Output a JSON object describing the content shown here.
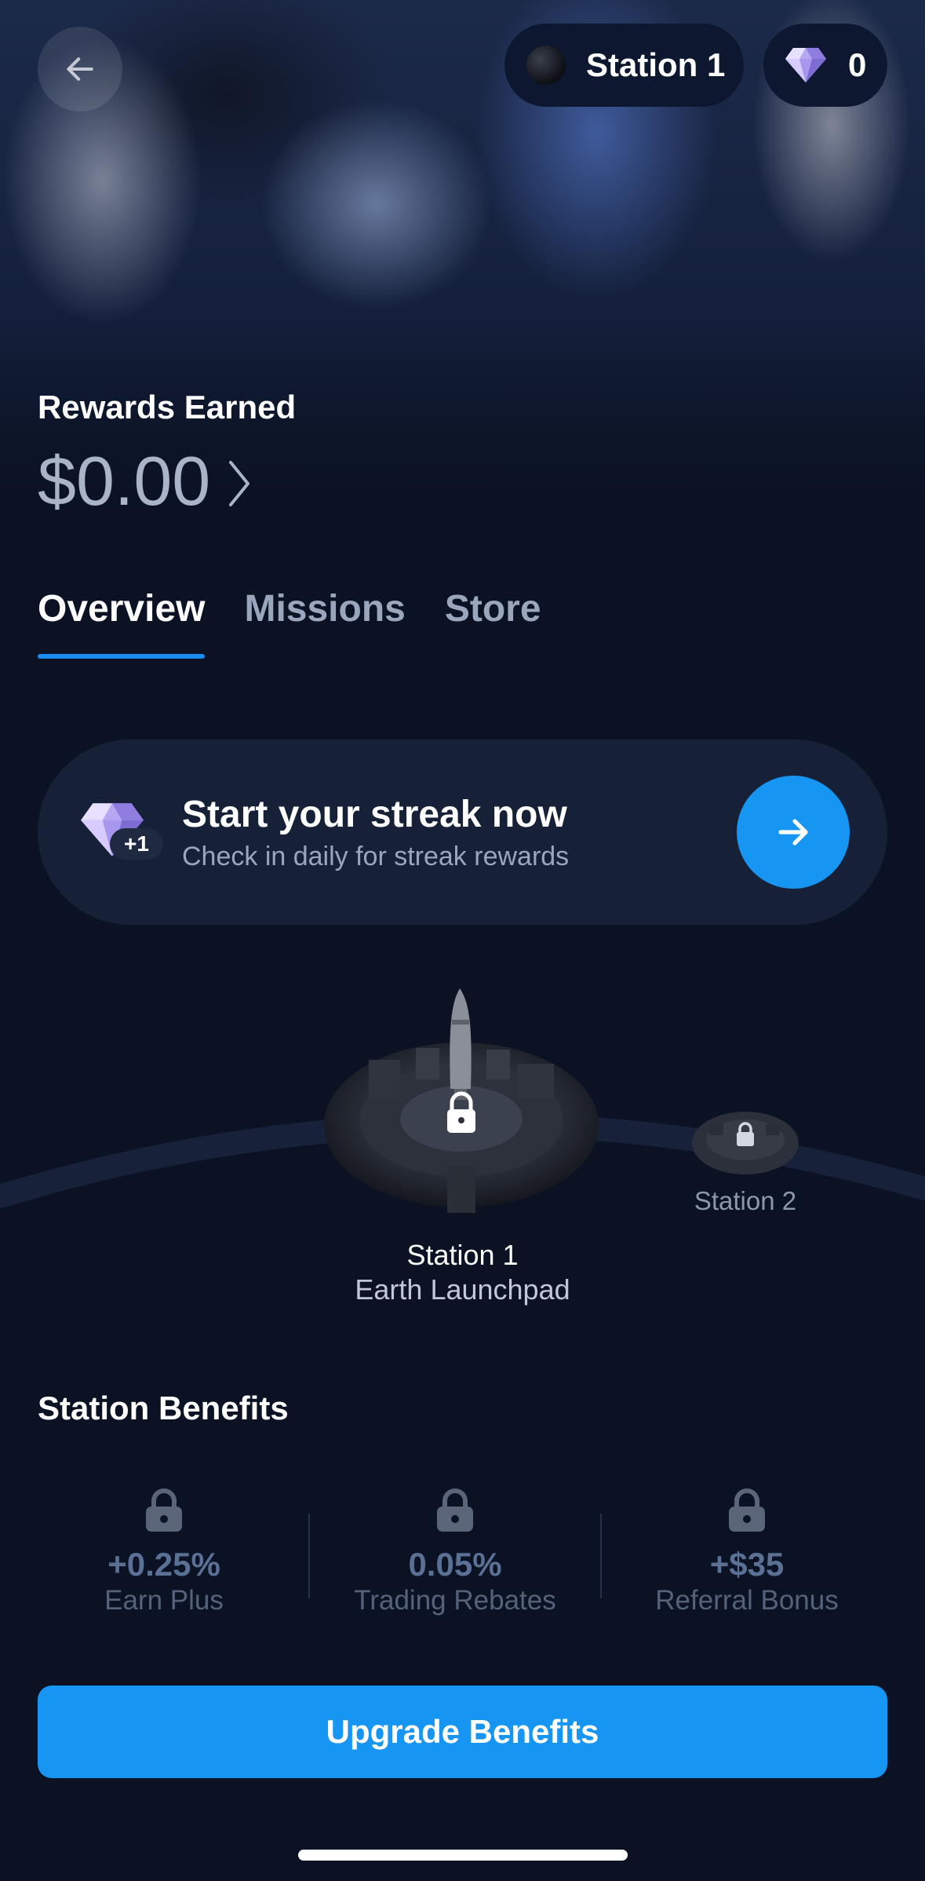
{
  "header": {
    "station_pill_label": "Station 1",
    "gem_count": "0",
    "back_icon": "arrow-left-icon"
  },
  "rewards": {
    "label": "Rewards Earned",
    "value": "$0.00"
  },
  "tabs": [
    {
      "label": "Overview",
      "active": true
    },
    {
      "label": "Missions",
      "active": false
    },
    {
      "label": "Store",
      "active": false
    }
  ],
  "streak": {
    "title": "Start your streak now",
    "subtitle": "Check in daily for streak rewards",
    "badge": "+1",
    "button_icon": "arrow-right-icon"
  },
  "stations": [
    {
      "name": "Station 1",
      "subtitle": "Earth Launchpad",
      "locked": true
    },
    {
      "name": "Station 2",
      "locked": true
    }
  ],
  "benefits": {
    "title": "Station Benefits",
    "items": [
      {
        "value": "+0.25%",
        "label": "Earn Plus",
        "locked": true
      },
      {
        "value": "0.05%",
        "label": "Trading Rebates",
        "locked": true
      },
      {
        "value": "+$35",
        "label": "Referral Bonus",
        "locked": true
      }
    ]
  },
  "cta": {
    "label": "Upgrade Benefits"
  },
  "colors": {
    "background": "#0b1224",
    "accent": "#1795f2",
    "card": "#162036",
    "muted_text": "#9aa6bc",
    "locked_value": "#5b7095"
  }
}
